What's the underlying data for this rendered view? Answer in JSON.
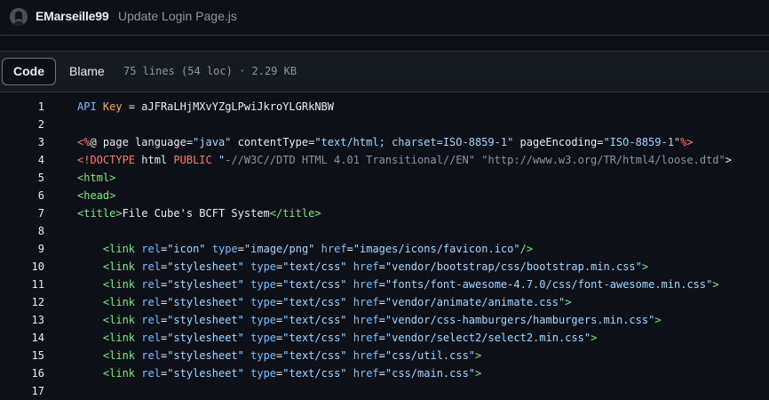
{
  "commit": {
    "author": "EMarseille99",
    "message": "Update Login Page.js"
  },
  "file_header": {
    "tabs": [
      "Code",
      "Blame"
    ],
    "active_tab": "Code",
    "stats": "75 lines (54 loc) · 2.29 KB"
  },
  "code": {
    "lines": [
      {
        "n": "1",
        "tokens": [
          [
            "a",
            "API "
          ],
          [
            "v",
            "Key"
          ],
          [
            "p",
            " = aJFRaLHjMXvYZgLPwiJkroYLGRkNBW"
          ]
        ]
      },
      {
        "n": "2",
        "tokens": []
      },
      {
        "n": "3",
        "tokens": [
          [
            "k",
            "<%"
          ],
          [
            "p",
            "@ page language="
          ],
          [
            "s",
            "\"java\""
          ],
          [
            "p",
            " contentType="
          ],
          [
            "s",
            "\"text/html; charset=ISO-8859-1\""
          ],
          [
            "p",
            " pageEncoding="
          ],
          [
            "s",
            "\"ISO-8859-1\""
          ],
          [
            "k",
            "%>"
          ]
        ]
      },
      {
        "n": "4",
        "tokens": [
          [
            "k",
            "<!DOCTYPE"
          ],
          [
            "p",
            " html "
          ],
          [
            "k",
            "PUBLIC"
          ],
          [
            "p",
            " "
          ],
          [
            "s",
            "\""
          ],
          [
            "c",
            "-//W3C//DTD HTML 4.01 Transitional//EN\""
          ],
          [
            "p",
            " "
          ],
          [
            "c",
            "\"http://www.w3.org/TR/html4/loose.dtd\""
          ],
          [
            "p",
            ">"
          ]
        ]
      },
      {
        "n": "5",
        "tokens": [
          [
            "t",
            "<html>"
          ]
        ]
      },
      {
        "n": "6",
        "tokens": [
          [
            "t",
            "<head>"
          ]
        ]
      },
      {
        "n": "7",
        "tokens": [
          [
            "t",
            "<title>"
          ],
          [
            "p",
            "File Cube's BCFT System"
          ],
          [
            "t",
            "</title>"
          ]
        ]
      },
      {
        "n": "8",
        "tokens": []
      },
      {
        "n": "9",
        "tokens": [
          [
            "p",
            "    "
          ],
          [
            "t",
            "<link"
          ],
          [
            "p",
            " "
          ],
          [
            "a",
            "rel"
          ],
          [
            "p",
            "="
          ],
          [
            "s",
            "\"icon\""
          ],
          [
            "p",
            " "
          ],
          [
            "a",
            "type"
          ],
          [
            "p",
            "="
          ],
          [
            "s",
            "\"image/png\""
          ],
          [
            "p",
            " "
          ],
          [
            "a",
            "href"
          ],
          [
            "p",
            "="
          ],
          [
            "s",
            "\"images/icons/favicon.ico\""
          ],
          [
            "t",
            "/>"
          ]
        ]
      },
      {
        "n": "10",
        "tokens": [
          [
            "p",
            "    "
          ],
          [
            "t",
            "<link"
          ],
          [
            "p",
            " "
          ],
          [
            "a",
            "rel"
          ],
          [
            "p",
            "="
          ],
          [
            "s",
            "\"stylesheet\""
          ],
          [
            "p",
            " "
          ],
          [
            "a",
            "type"
          ],
          [
            "p",
            "="
          ],
          [
            "s",
            "\"text/css\""
          ],
          [
            "p",
            " "
          ],
          [
            "a",
            "href"
          ],
          [
            "p",
            "="
          ],
          [
            "s",
            "\"vendor/bootstrap/css/bootstrap.min.css\""
          ],
          [
            "t",
            ">"
          ]
        ]
      },
      {
        "n": "11",
        "tokens": [
          [
            "p",
            "    "
          ],
          [
            "t",
            "<link"
          ],
          [
            "p",
            " "
          ],
          [
            "a",
            "rel"
          ],
          [
            "p",
            "="
          ],
          [
            "s",
            "\"stylesheet\""
          ],
          [
            "p",
            " "
          ],
          [
            "a",
            "type"
          ],
          [
            "p",
            "="
          ],
          [
            "s",
            "\"text/css\""
          ],
          [
            "p",
            " "
          ],
          [
            "a",
            "href"
          ],
          [
            "p",
            "="
          ],
          [
            "s",
            "\"fonts/font-awesome-4.7.0/css/font-awesome.min.css\""
          ],
          [
            "t",
            ">"
          ]
        ]
      },
      {
        "n": "12",
        "tokens": [
          [
            "p",
            "    "
          ],
          [
            "t",
            "<link"
          ],
          [
            "p",
            " "
          ],
          [
            "a",
            "rel"
          ],
          [
            "p",
            "="
          ],
          [
            "s",
            "\"stylesheet\""
          ],
          [
            "p",
            " "
          ],
          [
            "a",
            "type"
          ],
          [
            "p",
            "="
          ],
          [
            "s",
            "\"text/css\""
          ],
          [
            "p",
            " "
          ],
          [
            "a",
            "href"
          ],
          [
            "p",
            "="
          ],
          [
            "s",
            "\"vendor/animate/animate.css\""
          ],
          [
            "t",
            ">"
          ]
        ]
      },
      {
        "n": "13",
        "tokens": [
          [
            "p",
            "    "
          ],
          [
            "t",
            "<link"
          ],
          [
            "p",
            " "
          ],
          [
            "a",
            "rel"
          ],
          [
            "p",
            "="
          ],
          [
            "s",
            "\"stylesheet\""
          ],
          [
            "p",
            " "
          ],
          [
            "a",
            "type"
          ],
          [
            "p",
            "="
          ],
          [
            "s",
            "\"text/css\""
          ],
          [
            "p",
            " "
          ],
          [
            "a",
            "href"
          ],
          [
            "p",
            "="
          ],
          [
            "s",
            "\"vendor/css-hamburgers/hamburgers.min.css\""
          ],
          [
            "t",
            ">"
          ]
        ]
      },
      {
        "n": "14",
        "tokens": [
          [
            "p",
            "    "
          ],
          [
            "t",
            "<link"
          ],
          [
            "p",
            " "
          ],
          [
            "a",
            "rel"
          ],
          [
            "p",
            "="
          ],
          [
            "s",
            "\"stylesheet\""
          ],
          [
            "p",
            " "
          ],
          [
            "a",
            "type"
          ],
          [
            "p",
            "="
          ],
          [
            "s",
            "\"text/css\""
          ],
          [
            "p",
            " "
          ],
          [
            "a",
            "href"
          ],
          [
            "p",
            "="
          ],
          [
            "s",
            "\"vendor/select2/select2.min.css\""
          ],
          [
            "t",
            ">"
          ]
        ]
      },
      {
        "n": "15",
        "tokens": [
          [
            "p",
            "    "
          ],
          [
            "t",
            "<link"
          ],
          [
            "p",
            " "
          ],
          [
            "a",
            "rel"
          ],
          [
            "p",
            "="
          ],
          [
            "s",
            "\"stylesheet\""
          ],
          [
            "p",
            " "
          ],
          [
            "a",
            "type"
          ],
          [
            "p",
            "="
          ],
          [
            "s",
            "\"text/css\""
          ],
          [
            "p",
            " "
          ],
          [
            "a",
            "href"
          ],
          [
            "p",
            "="
          ],
          [
            "s",
            "\"css/util.css\""
          ],
          [
            "t",
            ">"
          ]
        ]
      },
      {
        "n": "16",
        "tokens": [
          [
            "p",
            "    "
          ],
          [
            "t",
            "<link"
          ],
          [
            "p",
            " "
          ],
          [
            "a",
            "rel"
          ],
          [
            "p",
            "="
          ],
          [
            "s",
            "\"stylesheet\""
          ],
          [
            "p",
            " "
          ],
          [
            "a",
            "type"
          ],
          [
            "p",
            "="
          ],
          [
            "s",
            "\"text/css\""
          ],
          [
            "p",
            " "
          ],
          [
            "a",
            "href"
          ],
          [
            "p",
            "="
          ],
          [
            "s",
            "\"css/main.css\""
          ],
          [
            "t",
            ">"
          ]
        ]
      },
      {
        "n": "17",
        "tokens": []
      }
    ]
  }
}
